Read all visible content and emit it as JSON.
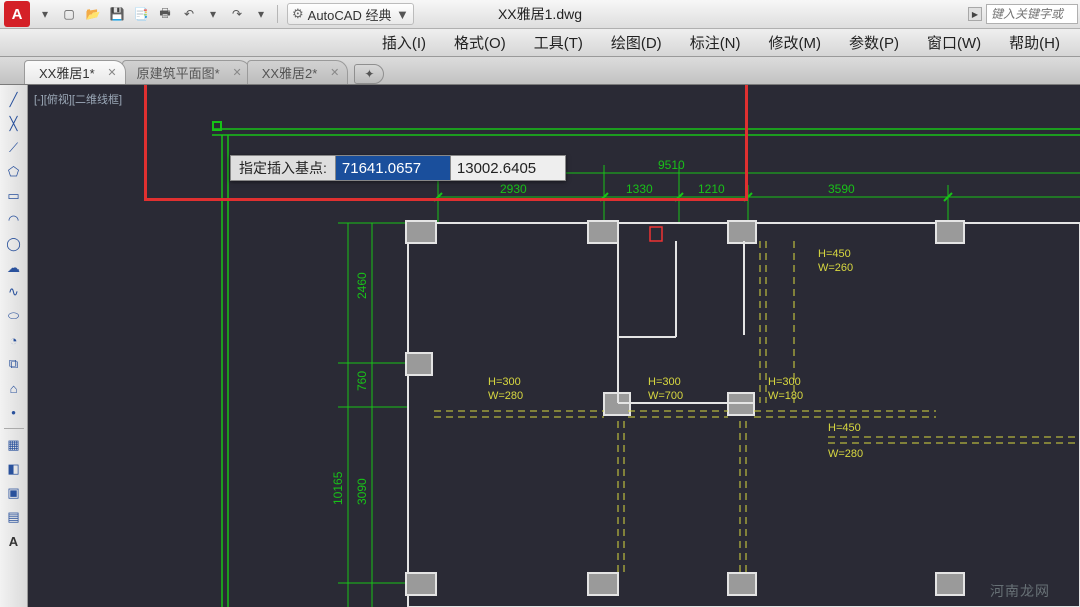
{
  "titlebar": {
    "workspace_label": "AutoCAD 经典",
    "document_title": "XX雅居1.dwg",
    "search_placeholder": "键入关键字或"
  },
  "menu": {
    "insert": "插入(I)",
    "format": "格式(O)",
    "tools": "工具(T)",
    "draw": "绘图(D)",
    "dimension": "标注(N)",
    "modify": "修改(M)",
    "parametric": "参数(P)",
    "window": "窗口(W)",
    "help": "帮助(H)"
  },
  "tabs": {
    "t1": "XX雅居1*",
    "t2": "原建筑平面图*",
    "t3": "XX雅居2*"
  },
  "canvas": {
    "view_label": "[-][俯视][二维线框]",
    "prompt_label": "指定插入基点:",
    "coord_x": "71641.0657",
    "coord_y": "13002.6405"
  },
  "dims": {
    "d_9510": "9510",
    "d_2930": "2930",
    "d_1330": "1330",
    "d_1210": "1210",
    "d_3590": "3590",
    "d_2460": "2460",
    "d_760": "760",
    "d_3090": "3090",
    "d_10165": "10165",
    "h450a": "H=450",
    "w260a": "W=260",
    "h300a": "H=300",
    "w280a": "W=280",
    "h300b": "H=300",
    "w700b": "W=700",
    "h300c": "H=300",
    "w180c": "W=180",
    "h450b": "H=450",
    "w280b": "W=280"
  },
  "watermark": "河南龙网"
}
